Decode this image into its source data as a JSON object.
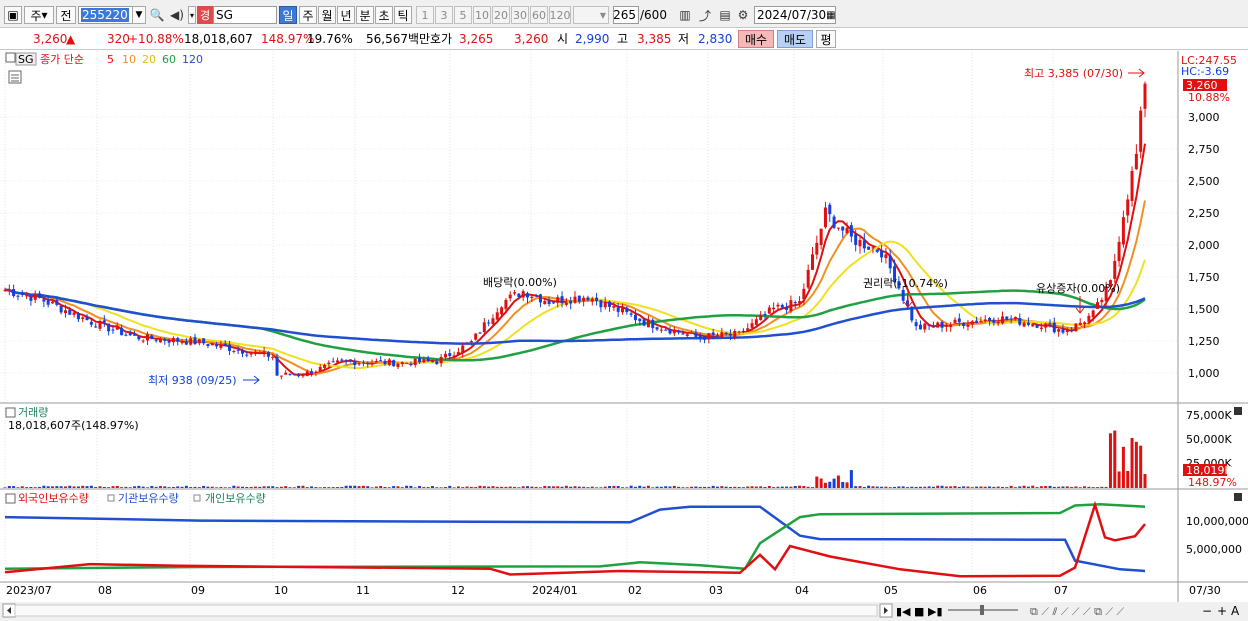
{
  "toolbar": {
    "market": "주",
    "prev_label": "전",
    "code": "255220",
    "name": "SG",
    "badge": "경",
    "periods": [
      "일",
      "주",
      "월",
      "년",
      "분",
      "초",
      "틱"
    ],
    "active_period": "일",
    "presets": [
      "1",
      "3",
      "5",
      "10",
      "20",
      "30",
      "60",
      "120"
    ],
    "count": "265",
    "count_total": "/600",
    "date": "2024/07/30"
  },
  "quote": {
    "price": "3,260",
    "arrow": "▲",
    "change": "320",
    "change_pct": "+10.88%",
    "volume": "18,018,607",
    "vol_ratio": "148.97%",
    "turnover": "19.76%",
    "amount": "56,567백만",
    "ask_label": "호가",
    "ask": "3,265",
    "bid": "3,260",
    "open_label": "시",
    "open": "2,990",
    "high_label": "고",
    "high": "3,385",
    "low_label": "저",
    "low": "2,830",
    "buy": "매수",
    "sell": "매도",
    "avg": "평"
  },
  "legend": {
    "code": "SG",
    "type": "종가 단순",
    "ma": [
      "5",
      "10",
      "20",
      "60",
      "120"
    ]
  },
  "annotations": {
    "high": "최고 3,385 (07/30)",
    "low": "최저 938 (09/25)",
    "dividend": "배당락(0.00%)",
    "rights": "권리락(-10.74%)",
    "capital": "유상증자(0.00%)"
  },
  "price_axis": {
    "lc": "LC:247.55",
    "hc": "HC:-3.69",
    "cur": "3,260",
    "cur_pct": "10.88%",
    "ticks": [
      "3,000",
      "2,750",
      "2,500",
      "2,250",
      "2,000",
      "1,750",
      "1,500",
      "1,250",
      "1,000"
    ]
  },
  "volume_panel": {
    "title": "거래량",
    "value": "18,018,607주(148.97%)",
    "ticks": [
      "75,000K",
      "50,000K",
      "25,000K"
    ],
    "cur": "18,019K",
    "cur_pct": "148.97%"
  },
  "holding_panel": {
    "series": [
      "외국인보유수량",
      "기관보유수량",
      "개인보유수량"
    ],
    "ticks": [
      "10,000,000",
      "5,000,000"
    ]
  },
  "xaxis": {
    "labels": [
      "2023/07",
      "08",
      "09",
      "10",
      "11",
      "12",
      "2024/01",
      "02",
      "03",
      "04",
      "05",
      "06",
      "07"
    ],
    "end": "07/30"
  },
  "colors": {
    "up": "#e01010",
    "down": "#1040e0",
    "ma5": "#e01010",
    "ma10": "#f09020",
    "ma20": "#f0e020",
    "ma60": "#20a040",
    "ma120": "#2050d0",
    "active": "#3c78d8"
  }
}
